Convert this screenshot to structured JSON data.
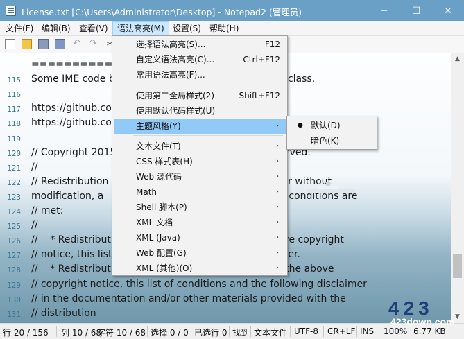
{
  "window": {
    "title": "License.txt [C:\\Users\\Administrator\\Desktop] - Notepad2 (管理员)",
    "minimize": "─",
    "maximize": "☐",
    "close": "✕",
    "icon": "notepad-icon"
  },
  "menubar": [
    {
      "label": "文件(F)"
    },
    {
      "label": "编辑(B)"
    },
    {
      "label": "查看(V)"
    },
    {
      "label": "语法高亮(M)"
    },
    {
      "label": "设置(S)"
    },
    {
      "label": "帮助(H)"
    }
  ],
  "toolbar": [
    "new-icon",
    "open-icon",
    "save-icon",
    "save-all-icon",
    "undo-icon",
    "redo-icon",
    "cut-icon"
  ],
  "editor": {
    "lines": [
      {
        "n": "",
        "t": "=========="
      },
      {
        "n": "115",
        "t": "Some IME code b                                                        class."
      },
      {
        "n": "116",
        "t": ""
      },
      {
        "n": "117",
        "t": "https://github.co"
      },
      {
        "n": "118",
        "t": "https://github.co"
      },
      {
        "n": "119",
        "t": ""
      },
      {
        "n": "120",
        "t": "// Copyright 2015                                                     erved."
      },
      {
        "n": "121",
        "t": "//"
      },
      {
        "n": "122",
        "t": "// Redistribution                                                    th or without"
      },
      {
        "n": "123",
        "t": "modification, a                                                       ng conditions are"
      },
      {
        "n": "124",
        "t": "// met:"
      },
      {
        "n": "125",
        "t": "//"
      },
      {
        "n": "126",
        "t": "//    * Redistributi                                                     ove copyright"
      },
      {
        "n": "127",
        "t": "// notice, this list                                                      mer."
      },
      {
        "n": "128",
        "t": "//    * Redistributions in binary form must reproduce the above"
      },
      {
        "n": "129",
        "t": "// copyright notice, this list of conditions and the following disclaimer"
      },
      {
        "n": "130",
        "t": "// in the documentation and/or other materials provided with the"
      },
      {
        "n": "131",
        "t": "// distribution"
      }
    ]
  },
  "syntax_menu": {
    "items": [
      {
        "label": "选择语法高亮(S)...",
        "accel": "F12"
      },
      {
        "label": "自定义语法高亮(C)...",
        "accel": "Ctrl+F12"
      },
      {
        "label": "常用语法高亮(F)...",
        "accel": ""
      },
      {
        "label": "使用第二全局样式(2)",
        "accel": "Shift+F12"
      },
      {
        "label": "使用默认代码样式(U)",
        "accel": ""
      },
      {
        "label": "主题风格(Y)",
        "accel": "",
        "sub": "›"
      },
      {
        "label": "文本文件(T)",
        "sub": "›"
      },
      {
        "label": "CSS 样式表(H)",
        "sub": "›"
      },
      {
        "label": "Web 源代码",
        "sub": "›"
      },
      {
        "label": "Math",
        "sub": "›"
      },
      {
        "label": "Shell 脚本(P)",
        "sub": "›"
      },
      {
        "label": "XML 文档",
        "sub": "›"
      },
      {
        "label": "XML (Java)",
        "sub": "›"
      },
      {
        "label": "Web 配置(G)",
        "sub": "›"
      },
      {
        "label": "XML (其他)(O)",
        "sub": "›"
      }
    ]
  },
  "theme_menu": {
    "items": [
      {
        "label": "默认(D)",
        "bullet": "●"
      },
      {
        "label": "暗色(K)",
        "bullet": ""
      }
    ]
  },
  "status": {
    "pos": "行 20 / 156",
    "col": "列 10 / 68",
    "chars": "字符 10 / 68",
    "sel": "选择 0 / 0",
    "selected": "已选行 0",
    "found": "找到",
    "type": "文本文件",
    "enc": "UTF-8",
    "eol": "CR+LF",
    "ins": "INS",
    "zoom": "100%",
    "size": "6.77 KB"
  },
  "watermark": {
    "logo": "423",
    "site": "423down.com"
  },
  "colors": {
    "titlebar": "#6aa0c6",
    "highlight": "#91c9f7",
    "line_numbers": "#3d7896"
  }
}
